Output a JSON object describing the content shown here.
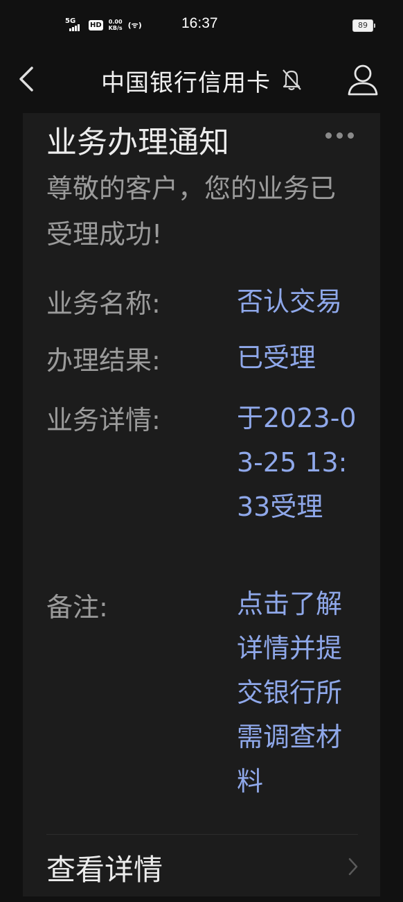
{
  "status_bar": {
    "signal": "5G",
    "hd": "HD",
    "net_speed": "0.00",
    "net_unit": "KB/s",
    "wifi_call": "(ᯤ)",
    "time": "16:37",
    "battery": "89"
  },
  "header": {
    "title": "中国银行信用卡"
  },
  "card": {
    "title": "业务办理通知",
    "intro": "尊敬的客户，您的业务已受理成功!",
    "rows": [
      {
        "label": "业务名称:",
        "value": "否认交易"
      },
      {
        "label": "办理结果:",
        "value": "已受理"
      },
      {
        "label": "业务详情:",
        "value": "于2023-03-25 13:33受理"
      },
      {
        "label": "备注:",
        "value": "点击了解详情并提交银行所需调查材料"
      }
    ],
    "details_link": "查看详情"
  },
  "colors": {
    "background": "#111111",
    "card": "#1c1c1c",
    "value_accent": "#8fa8ea",
    "label_gray": "#9b9b9b"
  }
}
